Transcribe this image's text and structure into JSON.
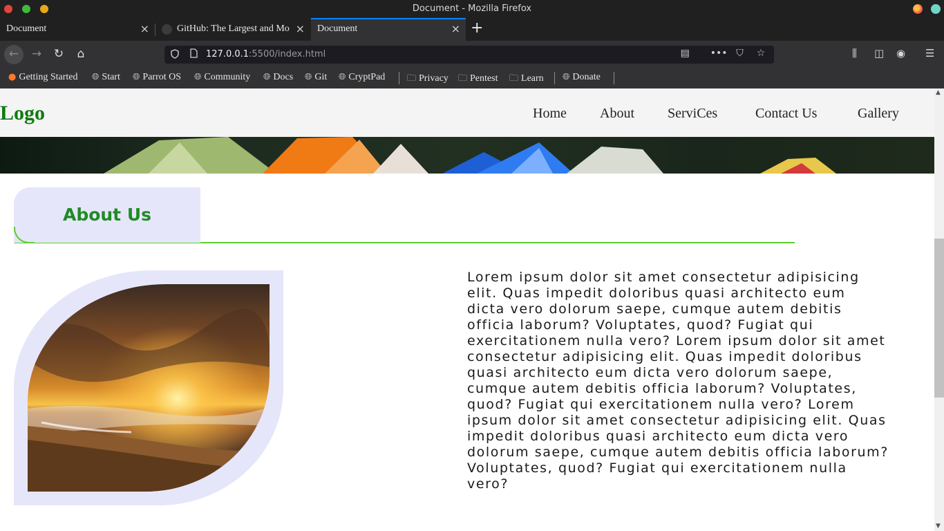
{
  "window": {
    "title": "Document - Mozilla Firefox"
  },
  "tabs": [
    {
      "label": "Document",
      "close": "×"
    },
    {
      "label": "GitHub: The Largest and Mo",
      "close": "×"
    },
    {
      "label": "Document",
      "close": "×"
    }
  ],
  "newtab_label": "+",
  "nav": {
    "back": "←",
    "forward": "→",
    "reload": "↻",
    "home": "⌂"
  },
  "urlbar": {
    "host": "127.0.0.1",
    "path": ":5500/index.html",
    "icons": [
      "reader-view-icon",
      "more-icon",
      "pocket-icon",
      "star-icon"
    ]
  },
  "bookmarks": [
    {
      "label": "Getting Started",
      "icon": "firefox-icon"
    },
    {
      "label": "Start",
      "icon": "globe-icon"
    },
    {
      "label": "Parrot OS",
      "icon": "globe-icon"
    },
    {
      "label": "Community",
      "icon": "globe-icon"
    },
    {
      "label": "Docs",
      "icon": "globe-icon"
    },
    {
      "label": "Git",
      "icon": "globe-icon"
    },
    {
      "label": "CryptPad",
      "icon": "globe-icon"
    },
    {
      "label": "Privacy",
      "icon": "folder-icon"
    },
    {
      "label": "Pentest",
      "icon": "folder-icon"
    },
    {
      "label": "Learn",
      "icon": "folder-icon"
    },
    {
      "label": "Donate",
      "icon": "globe-icon"
    }
  ],
  "site": {
    "logo": "Logo",
    "nav": [
      "Home",
      "About",
      "ServiCes",
      "Contact Us",
      "Gallery"
    ],
    "about_heading": "About Us",
    "about_text": "Lorem ipsum dolor sit amet consectetur adipisicing elit. Quas impedit doloribus quasi architecto eum dicta vero dolorum saepe, cumque autem debitis officia laborum? Voluptates, quod? Fugiat qui exercitationem nulla vero? Lorem ipsum dolor sit amet consectetur adipisicing elit. Quas impedit doloribus quasi architecto eum dicta vero dolorum saepe, cumque autem debitis officia laborum? Voluptates, quod? Fugiat qui exercitationem nulla vero? Lorem ipsum dolor sit amet consectetur adipisicing elit. Quas impedit doloribus quasi architecto eum dicta vero dolorum saepe, cumque autem debitis officia laborum? Voluptates, quod? Fugiat qui exercitationem nulla vero?",
    "accent_color": "#1f8b24",
    "line_color": "#59d12a",
    "panel_color": "#e6e6fa"
  }
}
